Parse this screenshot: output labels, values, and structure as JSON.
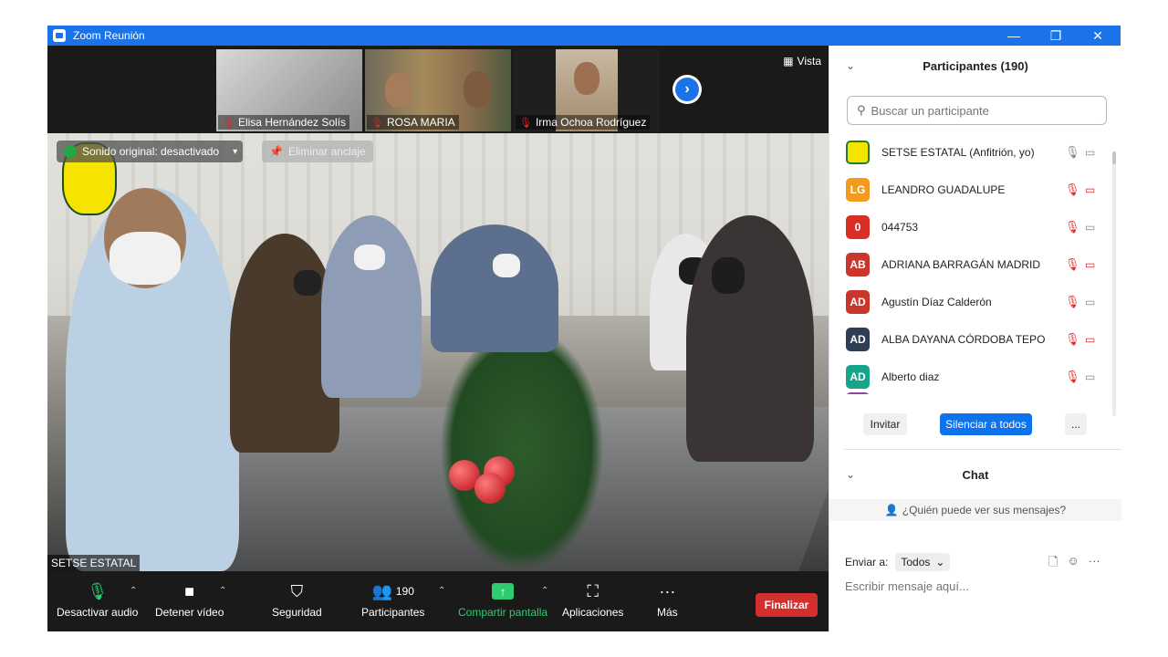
{
  "window": {
    "title": "Zoom Reunión",
    "minimize": "—",
    "restore": "❐",
    "close": "✕"
  },
  "strip": {
    "thumbnails": [
      {
        "name": "Elisa Hernández Solís"
      },
      {
        "name": "ROSA MARIA"
      },
      {
        "name": "Irma Ochoa Rodríguez"
      }
    ],
    "view_label": "Vista"
  },
  "main_video": {
    "original_sound": "Sonido original: desactivado",
    "unpin_label": "Eliminar anclaje",
    "speaker_name": "SETSE ESTATAL"
  },
  "toolbar": {
    "audio_label": "Desactivar audio",
    "video_label": "Detener vídeo",
    "security_label": "Seguridad",
    "participants_label": "Participantes",
    "participants_count": "190",
    "share_label": "Compartir pantalla",
    "apps_label": "Aplicaciones",
    "more_label": "Más",
    "end_label": "Finalizar"
  },
  "participants": {
    "title": "Participantes (190)",
    "search_placeholder": "Buscar un participante",
    "items": [
      {
        "initials": "",
        "name": "SETSE ESTATAL (Anfitrión, yo)",
        "color": "#f5e300",
        "muted": false,
        "video_off": false
      },
      {
        "initials": "LG",
        "name": " LEANDRO GUADALUPE",
        "color": "#f29a1d",
        "muted": true,
        "video_off": true
      },
      {
        "initials": "0",
        "name": "044753",
        "color": "#d93025",
        "muted": true,
        "video_off": false
      },
      {
        "initials": "AB",
        "name": "ADRIANA BARRAGÁN MADRID",
        "color": "#c9372c",
        "muted": true,
        "video_off": true
      },
      {
        "initials": "AD",
        "name": "Agustín Díaz Calderón",
        "color": "#c9372c",
        "muted": true,
        "video_off": false
      },
      {
        "initials": "AD",
        "name": "ALBA DAYANA CÓRDOBA TEPO",
        "color": "#2f3e55",
        "muted": true,
        "video_off": true
      },
      {
        "initials": "AD",
        "name": "Alberto diaz",
        "color": "#17a589",
        "muted": true,
        "video_off": false
      }
    ],
    "invite_label": "Invitar",
    "mute_all_label": "Silenciar a todos",
    "more_label": "..."
  },
  "chat": {
    "title": "Chat",
    "who_can_see": "¿Quién puede ver sus mensajes?",
    "send_to_label": "Enviar a:",
    "send_to_value": "Todos",
    "input_placeholder": "Escribir mensaje aquí..."
  }
}
